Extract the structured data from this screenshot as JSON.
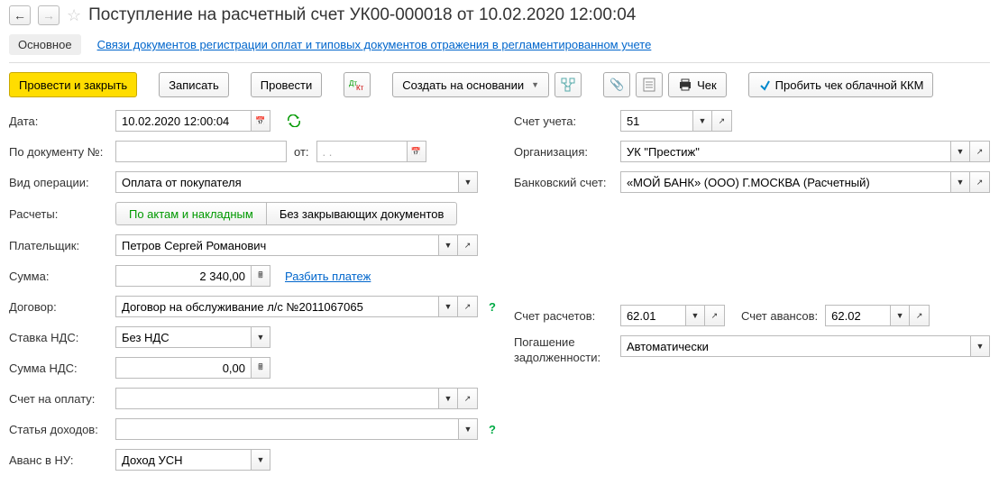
{
  "title": "Поступление на расчетный счет УК00-000018 от 10.02.2020 12:00:04",
  "tabs": {
    "main": "Основное",
    "link": "Связи документов регистрации оплат и типовых документов отражения в регламентированном учете"
  },
  "toolbar": {
    "post_close": "Провести и закрыть",
    "save": "Записать",
    "post": "Провести",
    "create_based": "Создать на основании",
    "check": "Чек",
    "cloud_kkm": "Пробить чек облачной ККМ"
  },
  "labels": {
    "date": "Дата:",
    "doc_no": "По документу №:",
    "from": "от:",
    "op_type": "Вид операции:",
    "calc": "Расчеты:",
    "payer": "Плательщик:",
    "sum": "Сумма:",
    "split": "Разбить платеж",
    "contract": "Договор:",
    "vat_rate": "Ставка НДС:",
    "vat_sum": "Сумма НДС:",
    "invoice": "Счет на оплату:",
    "income_art": "Статья доходов:",
    "advance": "Аванс в НУ:",
    "account": "Счет учета:",
    "org": "Организация:",
    "bank_acc": "Банковский счет:",
    "calc_acc": "Счет расчетов:",
    "advance_acc": "Счет авансов:",
    "debt_repay": "Погашение задолженности:"
  },
  "segments": {
    "by_acts": "По актам и накладным",
    "no_docs": "Без закрывающих документов"
  },
  "values": {
    "date": "10.02.2020 12:00:04",
    "doc_no": "",
    "doc_date": ". .",
    "op_type": "Оплата от покупателя",
    "payer": "Петров Сергей Романович",
    "sum": "2 340,00",
    "contract": "Договор на обслуживание л/с №2011067065",
    "vat_rate": "Без НДС",
    "vat_sum": "0,00",
    "invoice": "",
    "income_art": "",
    "advance": "Доход УСН",
    "account": "51",
    "org": "УК \"Престиж\"",
    "bank_acc": "«МОЙ БАНК» (ООО) Г.МОСКВА (Расчетный)",
    "calc_acc": "62.01",
    "advance_acc": "62.02",
    "debt_repay": "Автоматически"
  }
}
